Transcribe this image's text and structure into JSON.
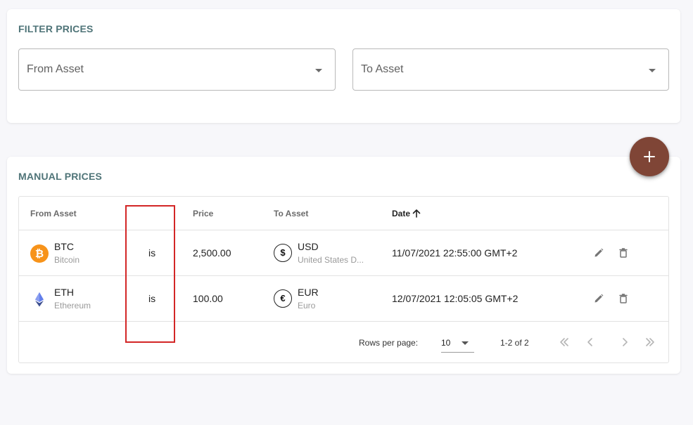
{
  "filter": {
    "title": "FILTER PRICES",
    "from_label": "From Asset",
    "to_label": "To Asset"
  },
  "manual": {
    "title": "MANUAL PRICES",
    "columns": [
      "From Asset",
      "Price",
      "To Asset",
      "Date"
    ],
    "sorted_column": "Date",
    "rows": [
      {
        "from_symbol": "BTC",
        "from_name": "Bitcoin",
        "from_icon": "bitcoin-icon",
        "relation": "is",
        "price": "2,500.00",
        "to_symbol": "USD",
        "to_name": "United States D...",
        "to_glyph": "$",
        "date": "11/07/2021 22:55:00 GMT+2"
      },
      {
        "from_symbol": "ETH",
        "from_name": "Ethereum",
        "from_icon": "ethereum-icon",
        "relation": "is",
        "price": "100.00",
        "to_symbol": "EUR",
        "to_name": "Euro",
        "to_glyph": "€",
        "date": "12/07/2021 12:05:05 GMT+2"
      }
    ],
    "footer": {
      "rows_per_page_label": "Rows per page:",
      "rows_per_page_value": "10",
      "page_info": "1-2 of 2"
    }
  },
  "colors": {
    "accent_title": "#4f7478",
    "fab": "#7f4536",
    "highlight": "#d32626",
    "bitcoin": "#f7931a",
    "ethereum": "#627eea"
  }
}
